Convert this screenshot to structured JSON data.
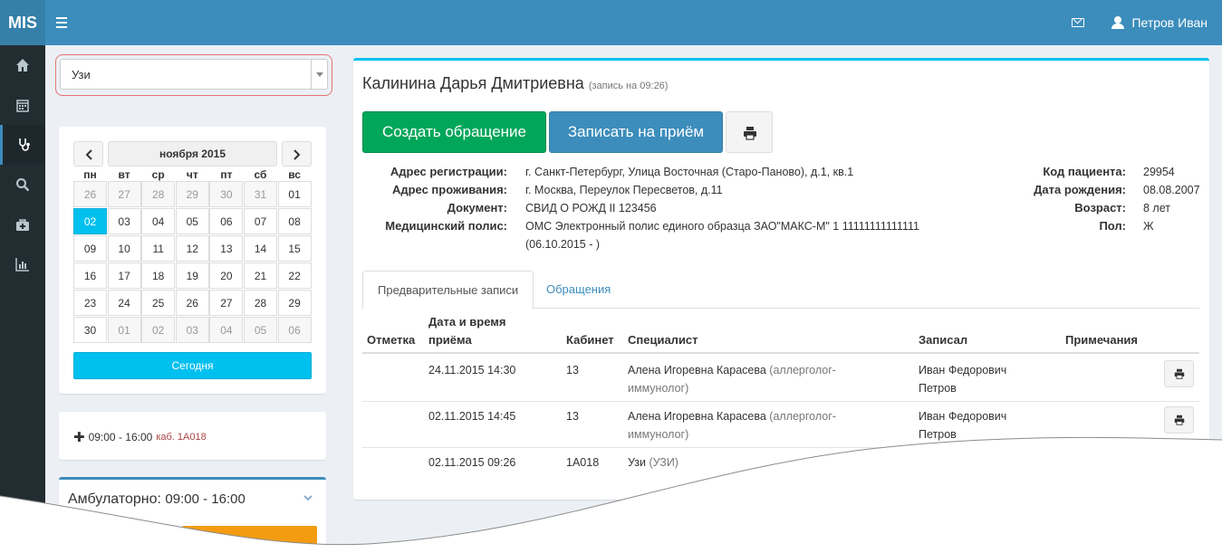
{
  "header": {
    "logo": "MIS",
    "user_name": "Петров Иван"
  },
  "sidebar": {
    "icons": [
      "home-icon",
      "calendar-icon",
      "stethoscope-icon",
      "search-icon",
      "medkit-icon",
      "bar-chart-icon"
    ],
    "active_index": 2
  },
  "left": {
    "select_value": "Узи",
    "calendar": {
      "month_label": "ноября 2015",
      "weekdays": [
        "пн",
        "вт",
        "ср",
        "чт",
        "пт",
        "сб",
        "вс"
      ],
      "weeks": [
        [
          "26",
          "27",
          "28",
          "29",
          "30",
          "31",
          "01"
        ],
        [
          "02",
          "03",
          "04",
          "05",
          "06",
          "07",
          "08"
        ],
        [
          "09",
          "10",
          "11",
          "12",
          "13",
          "14",
          "15"
        ],
        [
          "16",
          "17",
          "18",
          "19",
          "20",
          "21",
          "22"
        ],
        [
          "23",
          "24",
          "25",
          "26",
          "27",
          "28",
          "29"
        ],
        [
          "30",
          "01",
          "02",
          "03",
          "04",
          "05",
          "06"
        ]
      ],
      "selected": "02",
      "today_label": "Сегодня"
    },
    "slot": {
      "time": "09:00 - 16:00",
      "cabinet": "каб. 1А018"
    },
    "amb": {
      "label": "Амбулаторно:",
      "time": "09:00 - 16:00"
    }
  },
  "patient": {
    "name": "Калинина Дарья Дмитриевна",
    "note": "(запись на 09:26)",
    "buttons": {
      "create": "Создать обращение",
      "book": "Записать на приём"
    },
    "info": {
      "reg_label": "Адрес регистрации:",
      "reg_value": "г. Санкт-Петербург, Улица Восточная (Старо-Паново), д.1, кв.1",
      "live_label": "Адрес проживания:",
      "live_value": "г. Москва, Переулок Пересветов, д.11",
      "doc_label": "Документ:",
      "doc_value": "СВИД О РОЖД II 123456",
      "policy_label": "Медицинский полис:",
      "policy_value1": "ОМС Электронный полис единого образца ЗАО\"МАКС-М\" 1 11111111111111",
      "policy_value2": "(06.10.2015 - )",
      "code_label": "Код пациента:",
      "code_value": "29954",
      "dob_label": "Дата рождения:",
      "dob_value": "08.08.2007",
      "age_label": "Возраст:",
      "age_value": "8 лет",
      "sex_label": "Пол:",
      "sex_value": "Ж"
    },
    "tabs": [
      "Предварительные записи",
      "Обращения"
    ],
    "table": {
      "headers": {
        "mark": "Отметка",
        "datetime1": "Дата и время",
        "datetime2": "приёма",
        "cabinet": "Кабинет",
        "specialist": "Специалист",
        "recorded": "Записал",
        "notes": "Примечания"
      },
      "rows": [
        {
          "datetime": "24.11.2015 14:30",
          "cabinet": "13",
          "spec": "Алена Игоревна Карасева",
          "spec_role1": "(аллерголог-",
          "spec_role2": "иммунолог)",
          "rec1": "Иван Федорович",
          "rec2": "Петров"
        },
        {
          "datetime": "02.11.2015 14:45",
          "cabinet": "13",
          "spec": "Алена Игоревна Карасева",
          "spec_role1": "(аллерголог-",
          "spec_role2": "иммунолог)",
          "rec1": "Иван Федорович",
          "rec2": "Петров"
        },
        {
          "datetime": "02.11.2015 09:26",
          "cabinet": "1А018",
          "spec": "Узи",
          "spec_role1": "(УЗИ)",
          "spec_role2": "",
          "rec1": "",
          "rec2": ""
        }
      ]
    }
  },
  "colors": {
    "header": "#3c8dbc",
    "sidebar": "#222d32",
    "green": "#00a65a",
    "aqua": "#00c0ef",
    "orange": "#f39c12"
  }
}
